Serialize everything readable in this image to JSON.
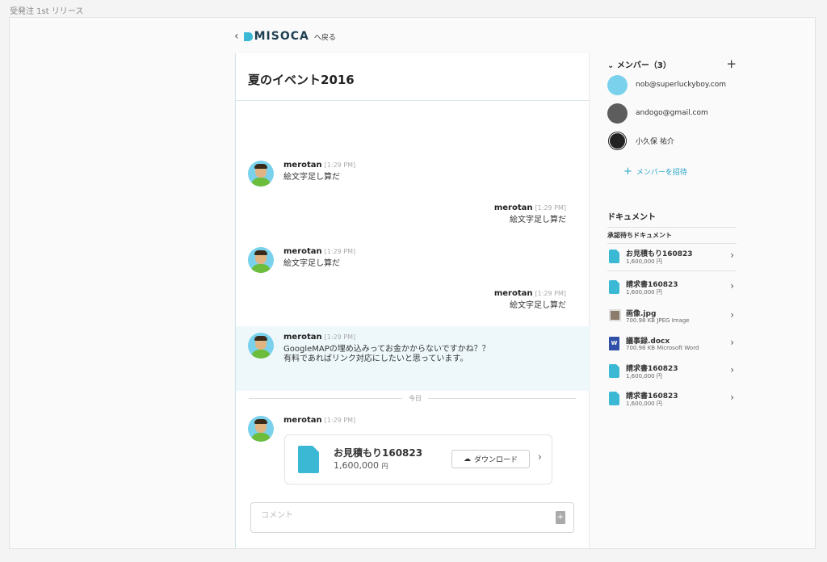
{
  "window": {
    "title": "受発注 1st リリース"
  },
  "back": {
    "logo": "MISOCA",
    "label": "へ戻る"
  },
  "chat": {
    "title": "夏のイベント2016",
    "messages": [
      {
        "user": "merotan",
        "time": "[1:29 PM]",
        "text": "絵文字足し算だ",
        "side": "left"
      },
      {
        "user": "merotan",
        "time": "[1:29 PM]",
        "text": "絵文字足し算だ",
        "side": "right"
      },
      {
        "user": "merotan",
        "time": "[1:29 PM]",
        "text": "絵文字足し算だ",
        "side": "left"
      },
      {
        "user": "merotan",
        "time": "[1:29 PM]",
        "text": "絵文字足し算だ",
        "side": "right"
      },
      {
        "user": "merotan",
        "time": "[1:29 PM]",
        "text": "GoogleMAPの埋め込みってお金かからないですかね？？\n有料であればリンク対応にしたいと思っています。",
        "side": "left",
        "highlighted": true
      }
    ],
    "divider_label": "今日",
    "last_message": {
      "user": "merotan",
      "time": "[1:29 PM]"
    },
    "file": {
      "name": "お見積もり160823",
      "price": "1,600,000",
      "unit": "円",
      "download_label": "ダウンロード"
    },
    "comment": {
      "placeholder": "コメント"
    }
  },
  "sidebar": {
    "members_title": "メンバー（3）",
    "members": [
      {
        "name": "nob@superluckyboy.com"
      },
      {
        "name": "andogo@gmail.com"
      },
      {
        "name": "小久保 祐介"
      }
    ],
    "invite_label": "メンバーを招待",
    "documents_title": "ドキュメント",
    "pending_title": "承認待ちドキュメント",
    "documents": [
      {
        "name": "お見積もり160823",
        "sub": "1,600,000 円",
        "icon": "doc-icon"
      },
      {
        "name": "請求書160823",
        "sub": "1,600,000 円",
        "icon": "doc-icon"
      },
      {
        "name": "画像.jpg",
        "sub": "700.98 KB JPEG Image",
        "icon": "image-icon"
      },
      {
        "name": "議事録.docx",
        "sub": "700.98 KB Microsoft Word",
        "icon": "word-icon"
      },
      {
        "name": "請求書160823",
        "sub": "1,600,000 円",
        "icon": "doc-icon"
      },
      {
        "name": "請求書160823",
        "sub": "1,600,000 円",
        "icon": "doc-icon"
      }
    ]
  }
}
